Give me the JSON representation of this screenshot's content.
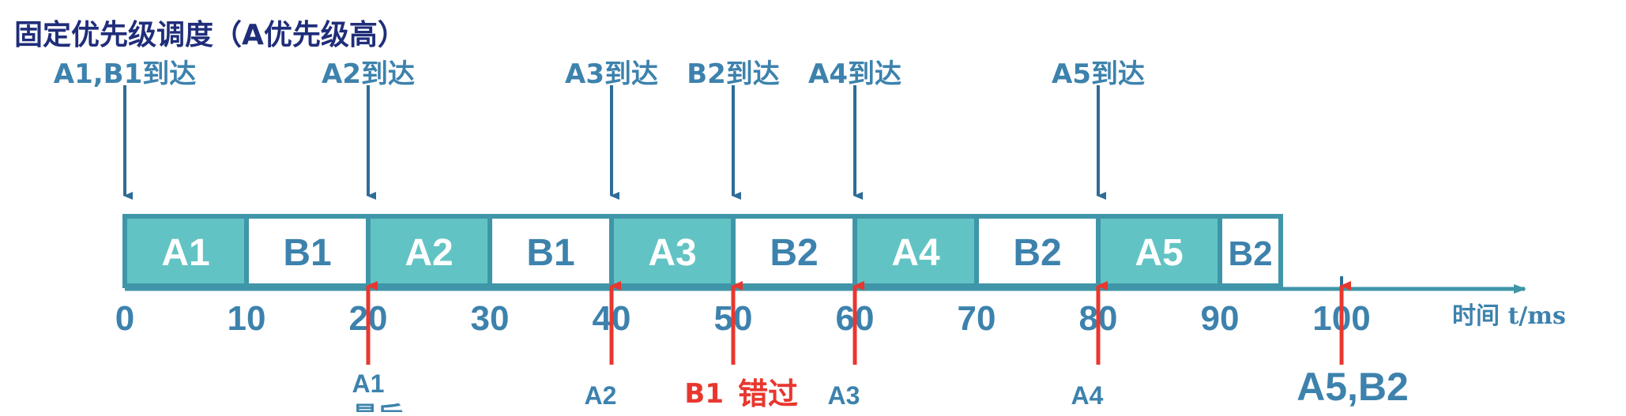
{
  "title": "固定优先级调度（A优先级高）",
  "colors": {
    "title": "#1f2d7a",
    "label_blue": "#3d82ad",
    "arrow_blue": "#2f6c98",
    "task_a_fill": "#62c3c4",
    "task_b_fill": "#ffffff",
    "border": "#3f96a8",
    "task_b_text": "#3d82ad",
    "deadline_red": "#e8372f"
  },
  "arrivals": [
    {
      "label": "A1,B1到达",
      "time": 0
    },
    {
      "label": "A2到达",
      "time": 20
    },
    {
      "label": "A3到达",
      "time": 40
    },
    {
      "label": "B2到达",
      "time": 50
    },
    {
      "label": "A4到达",
      "time": 60
    },
    {
      "label": "A5到达",
      "time": 80
    }
  ],
  "schedule": [
    {
      "task": "A1",
      "start": 0,
      "end": 10,
      "type": "A"
    },
    {
      "task": "B1",
      "start": 10,
      "end": 20,
      "type": "B"
    },
    {
      "task": "A2",
      "start": 20,
      "end": 30,
      "type": "A"
    },
    {
      "task": "B1",
      "start": 30,
      "end": 40,
      "type": "B"
    },
    {
      "task": "A3",
      "start": 40,
      "end": 50,
      "type": "A"
    },
    {
      "task": "B2",
      "start": 50,
      "end": 60,
      "type": "B"
    },
    {
      "task": "A4",
      "start": 60,
      "end": 70,
      "type": "A"
    },
    {
      "task": "B2",
      "start": 70,
      "end": 80,
      "type": "B"
    },
    {
      "task": "A5",
      "start": 80,
      "end": 90,
      "type": "A"
    },
    {
      "task": "B2",
      "start": 90,
      "end": 95,
      "type": "B"
    }
  ],
  "axis": {
    "ticks": [
      0,
      10,
      20,
      30,
      40,
      50,
      60,
      70,
      80,
      90,
      100
    ],
    "unit_label": "时间 t/ms",
    "range": [
      0,
      100
    ],
    "tick_mark_at": 100
  },
  "deadlines": [
    {
      "time": 20,
      "label": "A1",
      "sublabel": "最后",
      "miss_label": "",
      "style": "small"
    },
    {
      "time": 40,
      "label": "A2",
      "sublabel": "",
      "miss_label": "",
      "style": "small"
    },
    {
      "time": 50,
      "label": "B1",
      "sublabel": "",
      "miss_label": "错过",
      "style": "small"
    },
    {
      "time": 60,
      "label": "A3",
      "sublabel": "",
      "miss_label": "",
      "style": "small"
    },
    {
      "time": 80,
      "label": "A4",
      "sublabel": "",
      "miss_label": "",
      "style": "small"
    },
    {
      "time": 100,
      "label": "A5,B2",
      "sublabel": "",
      "miss_label": "",
      "style": "large"
    }
  ]
}
